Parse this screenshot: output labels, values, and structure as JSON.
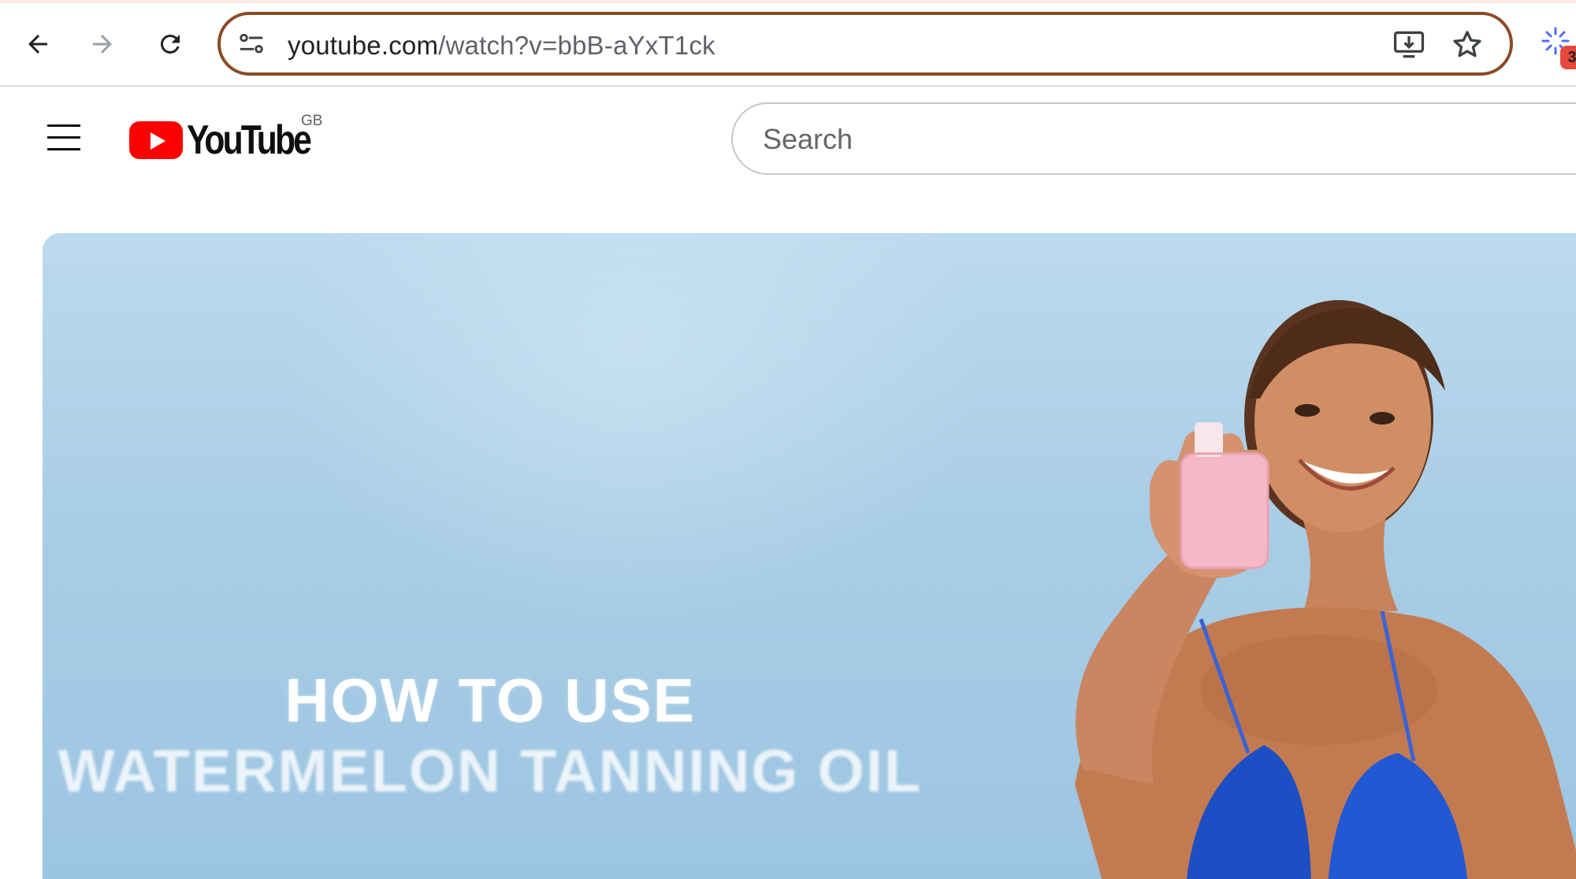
{
  "browser": {
    "url_host": "youtube.com",
    "url_path": "/watch?v=bbB-aYxT1ck",
    "omnibox_border_color": "#8a4a24",
    "extension_badge": "3",
    "icons": [
      "back-arrow-icon",
      "forward-arrow-icon",
      "reload-icon",
      "site-settings-icon",
      "install-app-icon",
      "bookmark-star-icon",
      "extension-icon"
    ]
  },
  "youtube": {
    "logo_text": "YouTube",
    "country_code": "GB",
    "search_placeholder": "Search",
    "brand_color": "#ff0000"
  },
  "video": {
    "caption_line1": "HOW TO USE",
    "caption_line2": "WATERMELON TANNING OIL"
  }
}
